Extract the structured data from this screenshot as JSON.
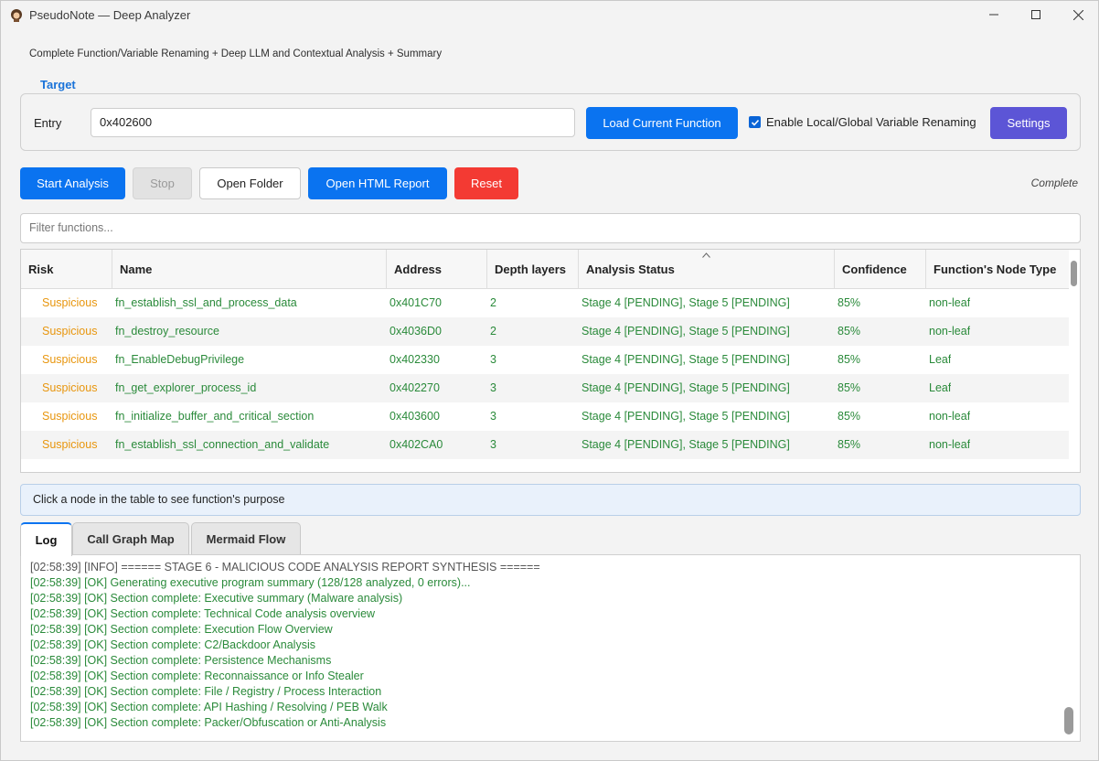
{
  "window": {
    "title": "PseudoNote — Deep Analyzer",
    "subtitle": "Complete Function/Variable Renaming + Deep LLM and Contextual Analysis + Summary"
  },
  "target": {
    "label": "Target",
    "entry_label": "Entry",
    "entry_value": "0x402600",
    "load_button": "Load Current Function",
    "rename_checkbox_label": "Enable Local/Global Variable Renaming",
    "rename_checked": true,
    "settings_button": "Settings"
  },
  "toolbar": {
    "start": "Start Analysis",
    "stop": "Stop",
    "open_folder": "Open Folder",
    "open_html": "Open HTML Report",
    "reset": "Reset",
    "status": "Complete"
  },
  "filter": {
    "placeholder": "Filter functions..."
  },
  "table": {
    "columns": [
      "Risk",
      "Name",
      "Address",
      "Depth layers",
      "Analysis Status",
      "Confidence",
      "Function's Node Type"
    ],
    "rows": [
      {
        "risk": "Suspicious",
        "name": "fn_establish_ssl_and_process_data",
        "address": "0x401C70",
        "depth": "2",
        "status": "Stage 4 [PENDING], Stage 5 [PENDING]",
        "confidence": "85%",
        "node_type": "non-leaf"
      },
      {
        "risk": "Suspicious",
        "name": "fn_destroy_resource",
        "address": "0x4036D0",
        "depth": "2",
        "status": "Stage 4 [PENDING], Stage 5 [PENDING]",
        "confidence": "85%",
        "node_type": "non-leaf"
      },
      {
        "risk": "Suspicious",
        "name": "fn_EnableDebugPrivilege",
        "address": "0x402330",
        "depth": "3",
        "status": "Stage 4 [PENDING], Stage 5 [PENDING]",
        "confidence": "85%",
        "node_type": "Leaf"
      },
      {
        "risk": "Suspicious",
        "name": "fn_get_explorer_process_id",
        "address": "0x402270",
        "depth": "3",
        "status": "Stage 4 [PENDING], Stage 5 [PENDING]",
        "confidence": "85%",
        "node_type": "Leaf"
      },
      {
        "risk": "Suspicious",
        "name": "fn_initialize_buffer_and_critical_section",
        "address": "0x403600",
        "depth": "3",
        "status": "Stage 4 [PENDING], Stage 5 [PENDING]",
        "confidence": "85%",
        "node_type": "non-leaf"
      },
      {
        "risk": "Suspicious",
        "name": "fn_establish_ssl_connection_and_validate",
        "address": "0x402CA0",
        "depth": "3",
        "status": "Stage 4 [PENDING], Stage 5 [PENDING]",
        "confidence": "85%",
        "node_type": "non-leaf"
      }
    ]
  },
  "info_bar": "Click a node in the table to see function's purpose",
  "tabs": [
    "Log",
    "Call Graph Map",
    "Mermaid Flow"
  ],
  "log": [
    {
      "level": "info",
      "text": "[02:58:39] [INFO] ====== STAGE 6 - MALICIOUS CODE ANALYSIS REPORT SYNTHESIS ======"
    },
    {
      "level": "ok",
      "text": "[02:58:39] [OK] Generating executive program summary (128/128 analyzed, 0 errors)..."
    },
    {
      "level": "ok",
      "text": "[02:58:39] [OK] Section complete: Executive summary (Malware analysis)"
    },
    {
      "level": "ok",
      "text": "[02:58:39] [OK] Section complete: Technical Code analysis overview"
    },
    {
      "level": "ok",
      "text": "[02:58:39] [OK] Section complete: Execution Flow Overview"
    },
    {
      "level": "ok",
      "text": "[02:58:39] [OK] Section complete: C2/Backdoor Analysis"
    },
    {
      "level": "ok",
      "text": "[02:58:39] [OK] Section complete: Persistence Mechanisms"
    },
    {
      "level": "ok",
      "text": "[02:58:39] [OK] Section complete: Reconnaissance or Info Stealer"
    },
    {
      "level": "ok",
      "text": "[02:58:39] [OK] Section complete: File / Registry / Process Interaction"
    },
    {
      "level": "ok",
      "text": "[02:58:39] [OK] Section complete: API Hashing / Resolving / PEB Walk"
    },
    {
      "level": "ok",
      "text": "[02:58:39] [OK] Section complete: Packer/Obfuscation or Anti-Analysis"
    }
  ],
  "colors": {
    "accent": "#0a73f0",
    "settings": "#5c55d6",
    "reset": "#f33a33",
    "risk_suspicious": "#e8960e",
    "ok_text": "#2a8a3a"
  }
}
